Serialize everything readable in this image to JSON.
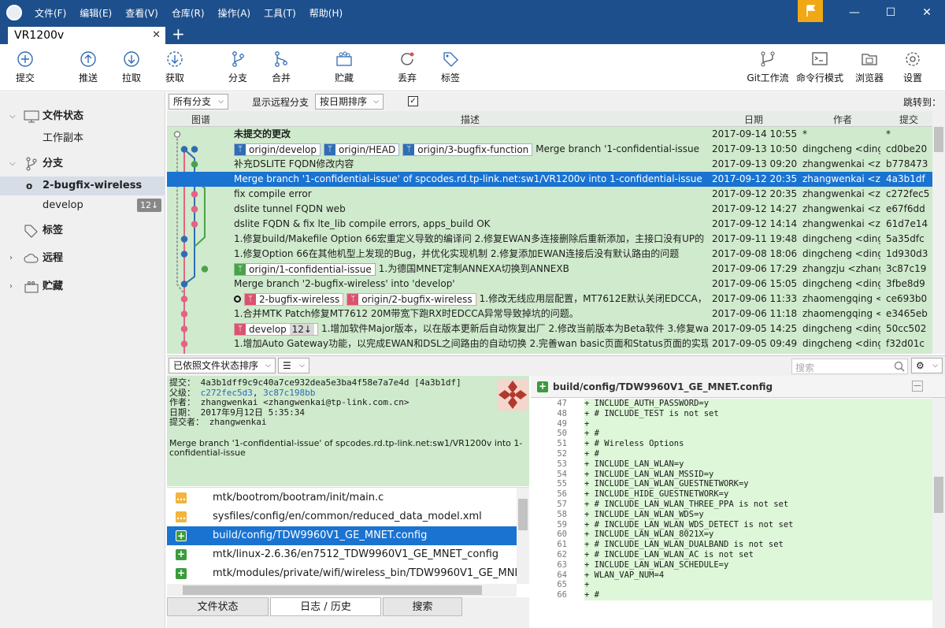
{
  "menus": [
    "文件(F)",
    "编辑(E)",
    "查看(V)",
    "仓库(R)",
    "操作(A)",
    "工具(T)",
    "帮助(H)"
  ],
  "window": {
    "tab_title": "VR1200v",
    "close_tab": "✕",
    "add_tab": "+"
  },
  "toolbar": {
    "commit": "提交",
    "push": "推送",
    "pull": "拉取",
    "fetch": "获取",
    "branch": "分支",
    "merge": "合并",
    "stash": "贮藏",
    "discard": "丢弃",
    "tag": "标签",
    "gitflow": "Git工作流",
    "terminal": "命令行模式",
    "explorer": "浏览器",
    "settings": "设置"
  },
  "sidebar": {
    "file_status": "文件状态",
    "working_copy": "工作副本",
    "branches": "分支",
    "branch_current": "2-bugfix-wireless",
    "branch_develop": "develop",
    "develop_badge": "12↓",
    "tags": "标签",
    "remotes": "远程",
    "stashes": "贮藏"
  },
  "filter": {
    "branches": "所有分支",
    "show_remote": "显示远程分支",
    "sort": "按日期排序",
    "jump": "跳转到："
  },
  "columns": {
    "graph": "图谱",
    "description": "描述",
    "date": "日期",
    "author": "作者",
    "commit": "提交"
  },
  "commits": [
    {
      "desc": "未提交的更改",
      "date": "2017-09-14 10:55",
      "author": "*",
      "hash": "*"
    },
    {
      "desc": "Merge branch '1-confidential-issue",
      "date": "2017-09-13 10:50",
      "author": "dingcheng <dingcheng@tp",
      "hash": "cd0be20"
    },
    {
      "desc": "补充DSLITE FQDN修改内容",
      "date": "2017-09-13 09:20",
      "author": "zhangwenkai <zhangwenkai",
      "hash": "b778473"
    },
    {
      "desc": "Merge branch '1-confidential-issue' of spcodes.rd.tp-link.net:sw1/VR1200v into 1-confidential-issue",
      "date": "2017-09-12 20:35",
      "author": "zhangwenkai <zhangwenkai",
      "hash": "4a3b1df"
    },
    {
      "desc": "fix compile error",
      "date": "2017-09-12 20:35",
      "author": "zhangwenkai <zhangwenkai",
      "hash": "c272fec5"
    },
    {
      "desc": "dslite tunnel FQDN web",
      "date": "2017-09-12 14:27",
      "author": "zhangwenkai <zhangwenkai",
      "hash": "e67f6dd"
    },
    {
      "desc": "dslite FQDN & fix lte_lib compile errors, apps_build OK",
      "date": "2017-09-12 14:14",
      "author": "zhangwenkai <zhangwenkai",
      "hash": "61d7e14"
    },
    {
      "desc": "1.修复build/Makefile Option 66宏重定义导致的编译问 2.修复EWAN多连接删除后重新添加，主接口没有UP的",
      "date": "2017-09-11 19:48",
      "author": "dingcheng <dingcheng",
      "hash": "5a35dfc"
    },
    {
      "desc": "1.修复Option 66在其他机型上发现的Bug，并优化实现机制 2.修复添加EWAN连接后没有默认路由的问题",
      "date": "2017-09-08 18:06",
      "author": "dingcheng <dingcheng",
      "hash": "1d930d3"
    },
    {
      "desc": "1.为德国MNET定制ANNEXA切换到ANNEXB",
      "date": "2017-09-06 17:29",
      "author": "zhangzju <zhangzju",
      "hash": "3c87c19"
    },
    {
      "desc": "Merge branch '2-bugfix-wireless' into 'develop'",
      "date": "2017-09-06 15:05",
      "author": "dingcheng <dingcheng",
      "hash": "3fbe8d9"
    },
    {
      "desc": "1.修改无线应用层配置，MT7612E默认关闭EDCCA，",
      "date": "2017-09-06 11:33",
      "author": "zhaomengqing <zhao",
      "hash": "ce693b0"
    },
    {
      "desc": "1.合并MTK Patch修复MT7612 20M带宽下跑RX时EDCCA异常导致掉坑的问题。",
      "date": "2017-09-06 11:18",
      "author": "zhaomengqing <zhao",
      "hash": "e3465eb"
    },
    {
      "desc": "1.增加软件Major版本，以在版本更新后自动恢复出厂 2.修改当前版本为Beta软件 3.修复wan",
      "date": "2017-09-05 14:25",
      "author": "dingcheng <dingcheng",
      "hash": "50cc502"
    },
    {
      "desc": "1.增加Auto Gateway功能，以完成EWAN和DSL之间路由的自动切换 2.完善wan basic页面和Status页面的实现",
      "date": "2017-09-05 09:49",
      "author": "dingcheng <dingcheng",
      "hash": "f32d01c"
    }
  ],
  "refs": {
    "origin_develop": "origin/develop",
    "origin_head": "origin/HEAD",
    "origin_bugfix_function": "origin/3-bugfix-function",
    "origin_confidential": "origin/1-confidential-issue",
    "bugfix_wireless": "2-bugfix-wireless",
    "origin_bugfix_wireless": "origin/2-bugfix-wireless",
    "develop": "develop",
    "develop_badge": "12↓"
  },
  "lower": {
    "sort": "已依照文件状态排序",
    "search_placeholder": "搜索"
  },
  "commit_detail": {
    "commit_label": "提交：",
    "commit_value": "4a3b1dff9c9c40a7ce932dea5e3ba4f58e7a7e4d [4a3b1df]",
    "parents_label": "父级：",
    "parent1": "c272fec5d3",
    "parent2": "3c87c198bb",
    "author_label": "作者：",
    "author_value": "zhangwenkai <zhangwenkai@tp-link.com.cn>",
    "date_label": "日期：",
    "date_value": "2017年9月12日 5:35:34",
    "committer_label": "提交者：",
    "committer_value": "zhangwenkai",
    "message": "Merge branch '1-confidential-issue' of spcodes.rd.tp-link.net:sw1/VR1200v into 1-confidential-issue"
  },
  "files": [
    {
      "status": "modified",
      "path": "mtk/bootrom/bootram/init/main.c"
    },
    {
      "status": "modified",
      "path": "sysfiles/config/en/common/reduced_data_model.xml"
    },
    {
      "status": "added",
      "path": "build/config/TDW9960V1_GE_MNET.config"
    },
    {
      "status": "added",
      "path": "mtk/linux-2.6.36/en7512_TDW9960V1_GE_MNET_config"
    },
    {
      "status": "added",
      "path": "mtk/modules/private/wifi/wireless_bin/TDW9960V1_GE_MNET/MT7"
    }
  ],
  "bottom_tabs": {
    "file_status": "文件状态",
    "log": "日志 / 历史",
    "search": "搜索"
  },
  "diff": {
    "file": "build/config/TDW9960V1_GE_MNET.config",
    "lines": [
      {
        "n": "47",
        "t": "+ INCLUDE_AUTH_PASSWORD=y"
      },
      {
        "n": "48",
        "t": "+ # INCLUDE_TEST is not set"
      },
      {
        "n": "49",
        "t": "+"
      },
      {
        "n": "50",
        "t": "+ #"
      },
      {
        "n": "51",
        "t": "+ # Wireless Options"
      },
      {
        "n": "52",
        "t": "+ #"
      },
      {
        "n": "53",
        "t": "+ INCLUDE_LAN_WLAN=y"
      },
      {
        "n": "54",
        "t": "+ INCLUDE_LAN_WLAN_MSSID=y"
      },
      {
        "n": "55",
        "t": "+ INCLUDE_LAN_WLAN_GUESTNETWORK=y"
      },
      {
        "n": "56",
        "t": "+ INCLUDE_HIDE_GUESTNETWORK=y"
      },
      {
        "n": "57",
        "t": "+ # INCLUDE_LAN_WLAN_THREE_PPA is not set"
      },
      {
        "n": "58",
        "t": "+ INCLUDE_LAN_WLAN_WDS=y"
      },
      {
        "n": "59",
        "t": "+ # INCLUDE_LAN_WLAN_WDS_DETECT is not set"
      },
      {
        "n": "60",
        "t": "+ INCLUDE_LAN_WLAN_8021X=y"
      },
      {
        "n": "61",
        "t": "+ # INCLUDE_LAN_WLAN_DUALBAND is not set"
      },
      {
        "n": "62",
        "t": "+ # INCLUDE_LAN_WLAN_AC is not set"
      },
      {
        "n": "63",
        "t": "+ INCLUDE_LAN_WLAN_SCHEDULE=y"
      },
      {
        "n": "64",
        "t": "+ WLAN_VAP_NUM=4"
      },
      {
        "n": "65",
        "t": "+"
      },
      {
        "n": "66",
        "t": "+ #"
      }
    ]
  },
  "colors": {
    "titlebar": "#1c4f8c",
    "accent": "#1a73d1",
    "log_bg": "#cfeacc",
    "flag": "#f0a814"
  }
}
